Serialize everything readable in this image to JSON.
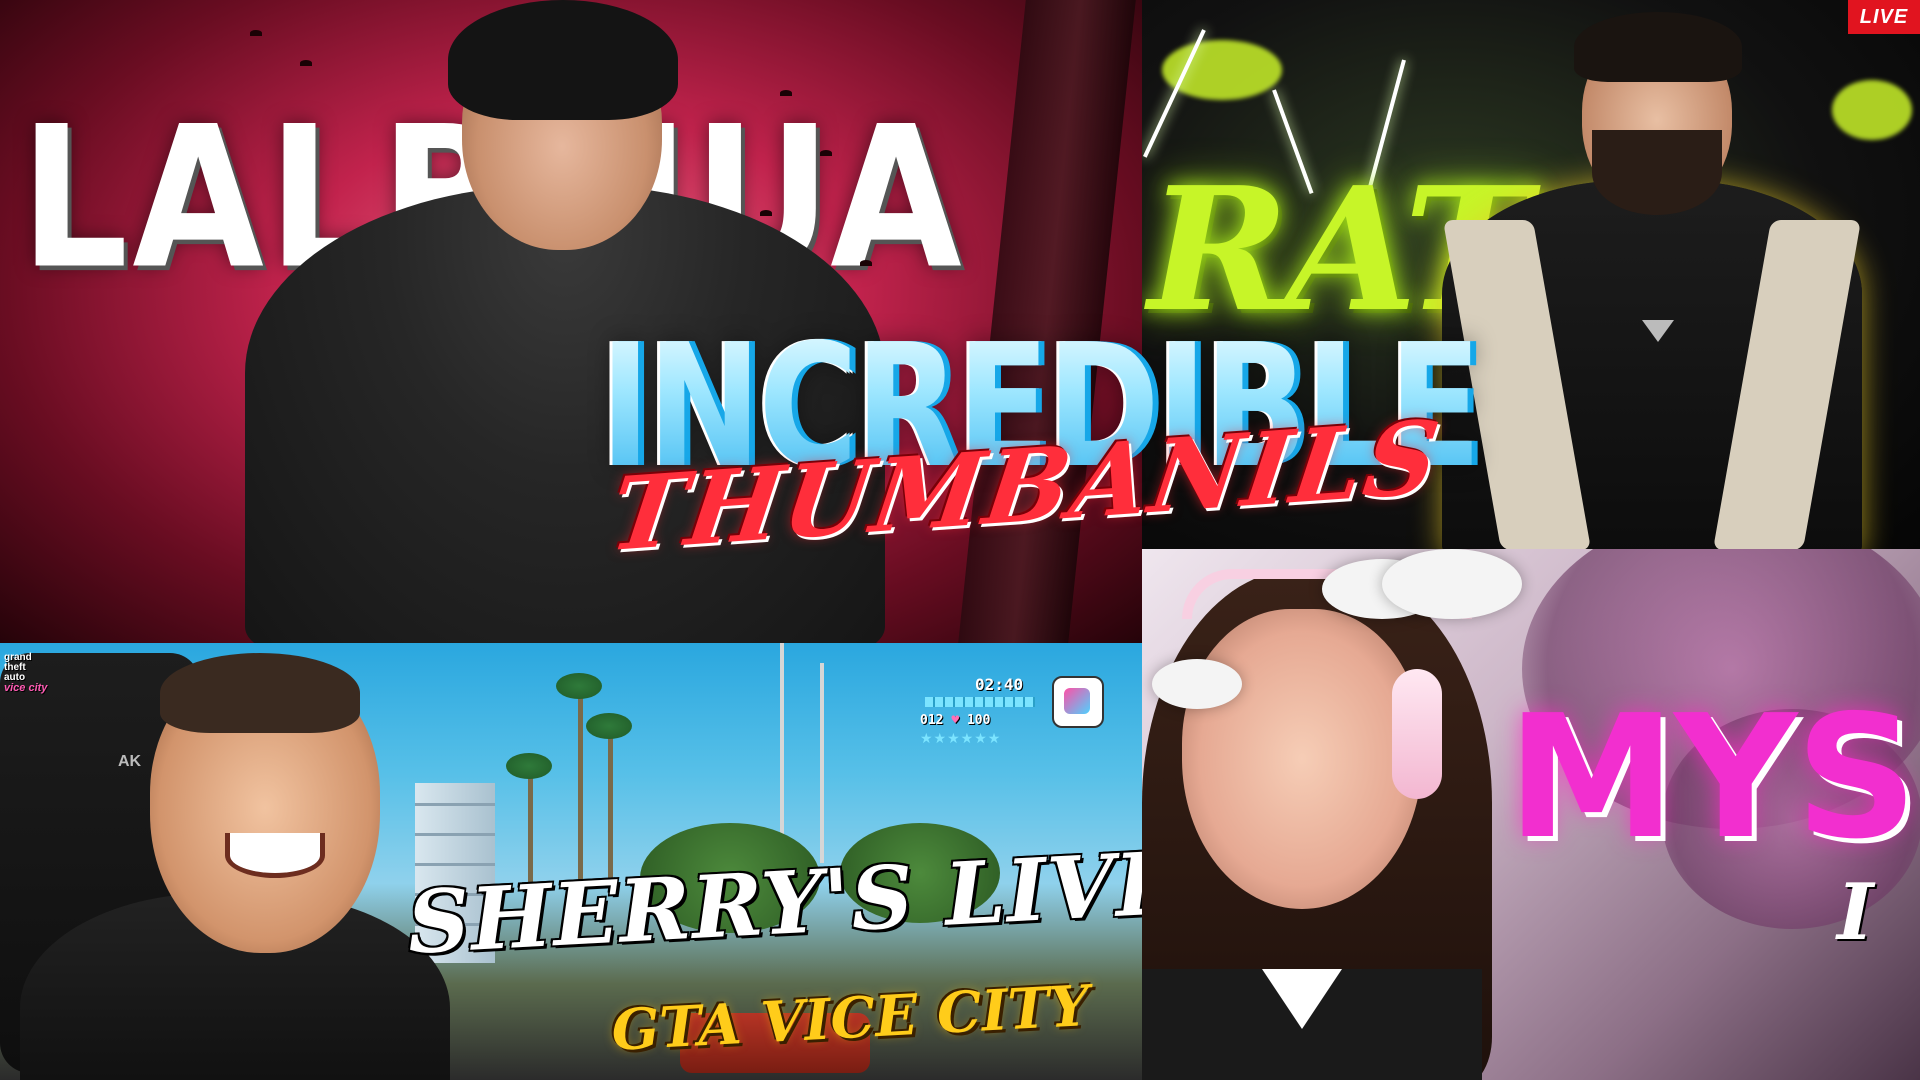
{
  "title": {
    "main": "INCREDIBLE",
    "sub": "THUMBANILS"
  },
  "panels": {
    "top_left": {
      "background_text": "LALBLIUA"
    },
    "top_right": {
      "neon_text": "RAT",
      "live_badge": "LIVE",
      "accent_color": "#c7f528",
      "badge_color": "#e1141f"
    },
    "bottom_left": {
      "game_logo": {
        "line1": "grand",
        "line2": "theft",
        "line3": "auto",
        "line4": "vice city"
      },
      "chair_brand": "AK",
      "hud": {
        "time": "02:40",
        "armor": "012",
        "health": "100",
        "stars": "★★★★★★"
      },
      "headline": "SHERRY'S LIVE",
      "subheadline": "GTA VICE CITY",
      "headline_color": "#ffffff",
      "subheadline_color": "#ffcc1a"
    },
    "bottom_right": {
      "headline": "MYS",
      "partial_text": "I",
      "headline_color": "#f22fcf"
    }
  }
}
